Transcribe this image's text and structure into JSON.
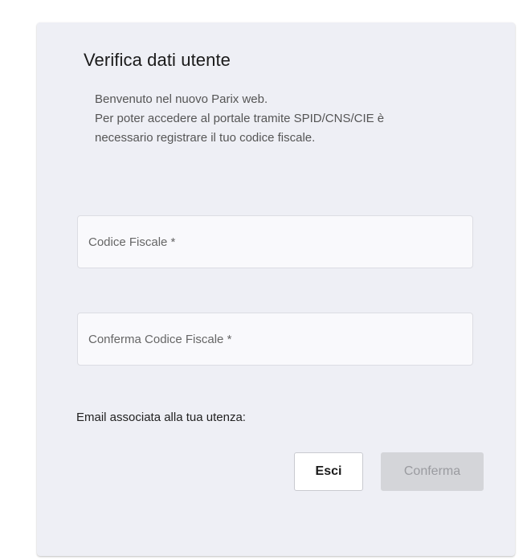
{
  "card": {
    "title": "Verifica dati utente",
    "intro_lines": [
      "Benvenuto nel nuovo Parix web.",
      "Per poter accedere al portale tramite SPID/CNS/CIE è",
      "necessario registrare il tuo codice fiscale."
    ]
  },
  "form": {
    "codice_fiscale": {
      "placeholder": "Codice Fiscale *",
      "value": ""
    },
    "conferma_codice_fiscale": {
      "placeholder": "Conferma Codice Fiscale *",
      "value": ""
    },
    "email_label": "Email associata alla tua utenza:"
  },
  "actions": {
    "esci_label": "Esci",
    "conferma_label": "Conferma",
    "conferma_disabled": true
  },
  "colors": {
    "card_background": "#eeeff5",
    "disabled_button": "#d4d5d9"
  }
}
